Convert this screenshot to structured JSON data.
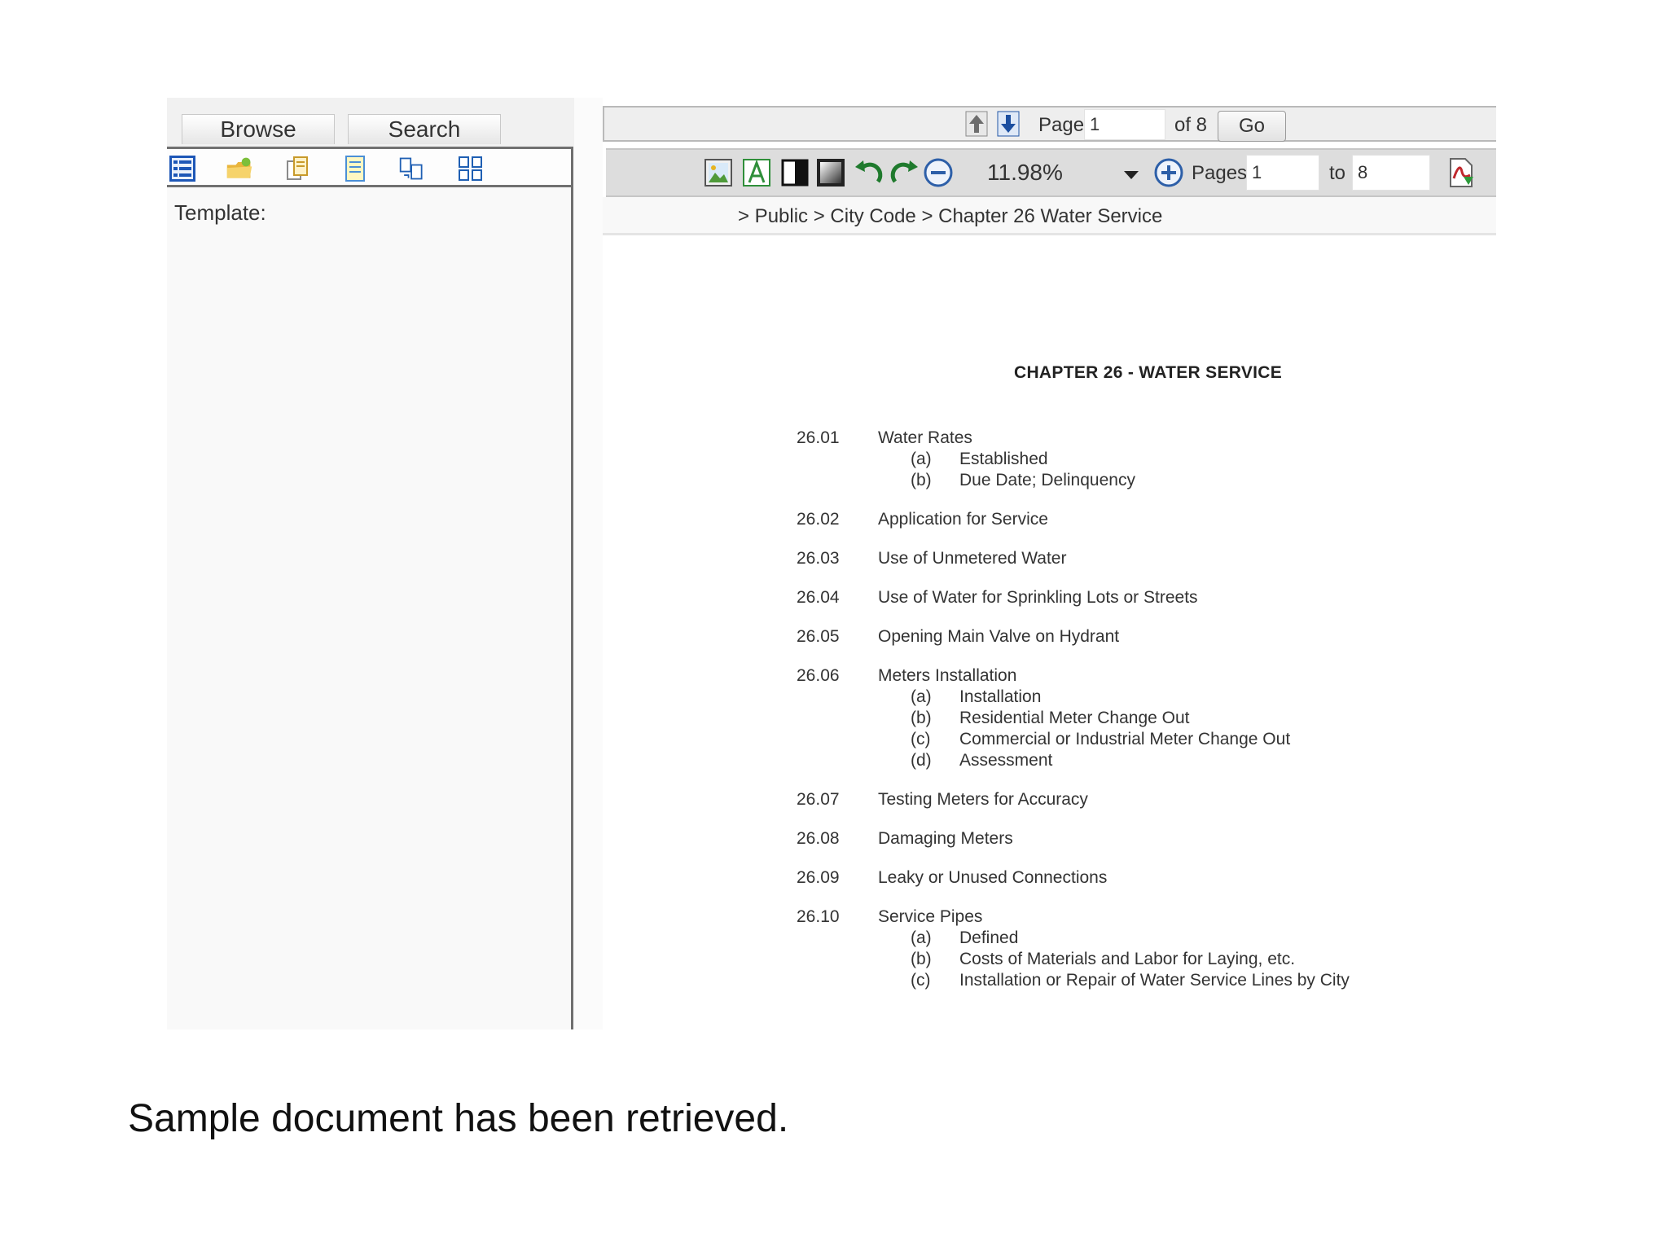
{
  "left_panel": {
    "tabs": [
      "Browse",
      "Search"
    ],
    "toolbar_icons": [
      "list-view-icon",
      "folder-icon",
      "copy-pages-icon",
      "document-icon",
      "compare-pages-icon",
      "thumbnails-icon"
    ],
    "template_label": "Template:"
  },
  "viewer": {
    "nav": {
      "page_label": "Page",
      "page_value": "1",
      "of_label": "of 8",
      "go_label": "Go"
    },
    "tools": {
      "zoom_value": "11.98%",
      "pages_label": "Pages",
      "pages_from": "1",
      "to_label": "to",
      "pages_to": "8"
    },
    "breadcrumb": "> Public > City Code > Chapter 26 Water Service"
  },
  "document": {
    "title": "CHAPTER 26 - WATER SERVICE",
    "sections": [
      {
        "num": "26.01",
        "title": "Water Rates",
        "subs": [
          {
            "letter": "(a)",
            "text": "Established"
          },
          {
            "letter": "(b)",
            "text": "Due Date; Delinquency"
          }
        ]
      },
      {
        "num": "26.02",
        "title": "Application for Service",
        "subs": []
      },
      {
        "num": "26.03",
        "title": "Use of Unmetered Water",
        "subs": []
      },
      {
        "num": "26.04",
        "title": "Use of Water for Sprinkling Lots or Streets",
        "subs": []
      },
      {
        "num": "26.05",
        "title": "Opening Main Valve on Hydrant",
        "subs": []
      },
      {
        "num": "26.06",
        "title": "Meters Installation",
        "subs": [
          {
            "letter": "(a)",
            "text": "Installation"
          },
          {
            "letter": "(b)",
            "text": "Residential Meter Change Out"
          },
          {
            "letter": "(c)",
            "text": "Commercial or Industrial Meter Change Out"
          },
          {
            "letter": "(d)",
            "text": "Assessment"
          }
        ]
      },
      {
        "num": "26.07",
        "title": "Testing Meters for Accuracy",
        "subs": []
      },
      {
        "num": "26.08",
        "title": "Damaging Meters",
        "subs": []
      },
      {
        "num": "26.09",
        "title": "Leaky or Unused Connections",
        "subs": []
      },
      {
        "num": "26.10",
        "title": "Service Pipes",
        "subs": [
          {
            "letter": "(a)",
            "text": "Defined"
          },
          {
            "letter": "(b)",
            "text": "Costs of Materials and Labor for Laying, etc."
          },
          {
            "letter": "(c)",
            "text": "Installation or Repair of Water Service Lines by City"
          }
        ]
      }
    ]
  },
  "caption": "Sample document has been retrieved."
}
